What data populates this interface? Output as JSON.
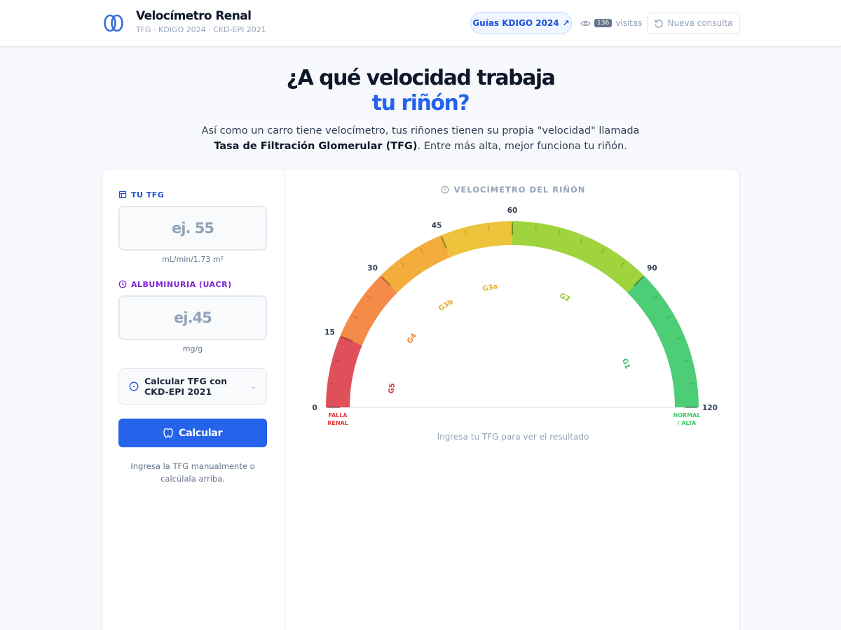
{
  "header": {
    "title": "Velocímetro Renal",
    "subtitle": "TFG · KDIGO 2024 · CKD-EPI 2021",
    "guides_label": "Guías KDIGO 2024",
    "guides_arrow": "↗",
    "visits_count": "136",
    "visits_label": "visitas",
    "new_label": "Nueva consulta"
  },
  "hero": {
    "line1": "¿A qué velocidad trabaja",
    "line2": "tu riñón?",
    "desc_pre": "Así como un carro tiene velocímetro, tus riñones tienen su propia \"velocidad\" llamada ",
    "desc_bold": "Tasa de Filtración Glomerular (TFG)",
    "desc_post": ". Entre más alta, mejor funciona tu riñón."
  },
  "form": {
    "tfg_label": "TU TFG",
    "tfg_placeholder": "ej. 55",
    "tfg_value": "",
    "tfg_unit": "mL/min/1.73 m²",
    "alb_label": "ALBUMINURIA (UACR)",
    "alb_placeholder": "ej.45",
    "alb_value": "",
    "alb_unit": "mg/g",
    "calc_toggle_label": "Calcular TFG con CKD-EPI 2021",
    "calc_button": "Calcular",
    "hint": "Ingresa la TFG manualmente o calcúlala arriba."
  },
  "gauge": {
    "title": "VELOCÍMETRO DEL RIÑÓN",
    "message": "Ingresa tu TFG para ver el resultado",
    "min": 0,
    "max": 120,
    "major_ticks": [
      0,
      15,
      30,
      45,
      60,
      90,
      120
    ],
    "bands": [
      {
        "from": 0,
        "to": 15,
        "color": "#e0505a",
        "stage": "G5"
      },
      {
        "from": 15,
        "to": 30,
        "color": "#f58b48",
        "stage": "G4"
      },
      {
        "from": 30,
        "to": 45,
        "color": "#f3ad3d",
        "stage": "G3b"
      },
      {
        "from": 45,
        "to": 60,
        "color": "#ecc33a",
        "stage": "G3a"
      },
      {
        "from": 60,
        "to": 90,
        "color": "#9fd43e",
        "stage": "G2"
      },
      {
        "from": 90,
        "to": 120,
        "color": "#4ecd77",
        "stage": "G1"
      }
    ],
    "stage_colors": {
      "G5": "#d93a3a",
      "G4": "#f0842f",
      "G3b": "#e9a82a",
      "G3a": "#e3b523",
      "G2": "#8ec92a",
      "G1": "#3ec765"
    },
    "stage_label_values": {
      "G5": 6,
      "G4": 23,
      "G3b": 38,
      "G3a": 53,
      "G2": 77,
      "G1": 106
    },
    "end_labels": {
      "left": [
        "FALLA",
        "RENAL"
      ],
      "right": [
        "NORMAL",
        "/ ALTA"
      ]
    },
    "end_colors": {
      "left": "#d93a3a",
      "right": "#3ec765"
    }
  }
}
